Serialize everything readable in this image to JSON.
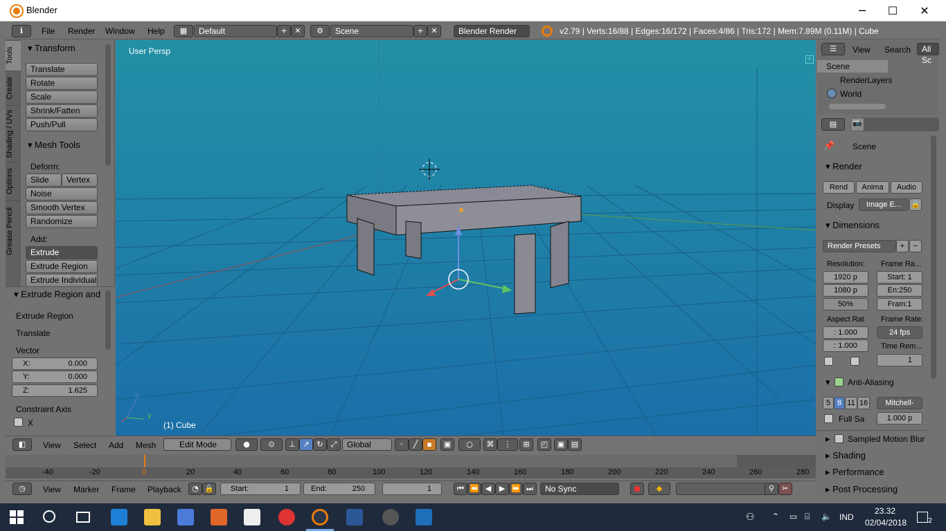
{
  "window": {
    "title": "Blender",
    "minimize": "─",
    "maximize": "☐",
    "close": "✕"
  },
  "menubar": {
    "info_icon": "ℹ",
    "menus": [
      "File",
      "Render",
      "Window",
      "Help"
    ],
    "screen_layout": "Default",
    "scene": "Scene",
    "render_engine": "Blender Render",
    "stats": "v2.79 | Verts:16/88 | Edges:16/172 | Faces:4/86 | Tris:172 | Mem:7.89M (0.11M) | Cube"
  },
  "tool_tabs": [
    "Tools",
    "Create",
    "Shading / UVs",
    "Options",
    "Grease Pencil"
  ],
  "transform_panel": {
    "title": "Transform",
    "buttons": [
      "Translate",
      "Rotate",
      "Scale",
      "Shrink/Fatten",
      "Push/Pull"
    ]
  },
  "mesh_tools_panel": {
    "title": "Mesh Tools",
    "deform_label": "Deform:",
    "slide_edge": "Slide Ed",
    "vertex": "Vertex",
    "buttons": [
      "Noise",
      "Smooth Vertex",
      "Randomize"
    ],
    "add_label": "Add:",
    "extrude": "Extrude",
    "extrude_region": "Extrude Region",
    "extrude_individual": "Extrude Individual"
  },
  "operator_panel": {
    "title": "Extrude Region and",
    "line1": "Extrude Region",
    "line2": "Translate",
    "vector_label": "Vector",
    "x_label": "X:",
    "x_value": "0.000",
    "y_label": "Y:",
    "y_value": "0.000",
    "z_label": "Z:",
    "z_value": "1.625",
    "constraint_label": "Constraint Axis",
    "constraint_x": "X"
  },
  "viewport": {
    "view_name": "User Persp",
    "object_label": "(1) Cube",
    "axis_z": "z",
    "axis_y": "y"
  },
  "view3d_header": {
    "menus": [
      "View",
      "Select",
      "Add",
      "Mesh"
    ],
    "mode": "Edit Mode",
    "orientation": "Global"
  },
  "timeline": {
    "ruler_ticks": [
      "-40",
      "-20",
      "0",
      "20",
      "40",
      "60",
      "80",
      "100",
      "120",
      "140",
      "160",
      "180",
      "200",
      "220",
      "240",
      "260",
      "280"
    ],
    "menus": [
      "View",
      "Marker",
      "Frame",
      "Playback"
    ],
    "start_label": "Start:",
    "start_value": "1",
    "end_label": "End:",
    "end_value": "250",
    "current_frame": "1",
    "sync": "No Sync"
  },
  "outliner": {
    "view": "View",
    "search": "Search",
    "filter": "All Sc",
    "items": [
      "Scene",
      "RenderLayers",
      "World"
    ]
  },
  "properties": {
    "context": "Scene",
    "render_panel": {
      "title": "Render",
      "render_btn": "Rend",
      "anim_btn": "Anima",
      "audio_btn": "Audio",
      "display_label": "Display",
      "display_value": "Image E..."
    },
    "dimensions_panel": {
      "title": "Dimensions",
      "presets": "Render Presets",
      "resolution_label": "Resolution:",
      "res_x": "1920 p",
      "res_y": "1080 p",
      "res_pct": "50%",
      "frame_range_label": "Frame Ra...",
      "start": "Start: 1",
      "end": "En:250",
      "step": "Fram:1",
      "aspect_label": "Aspect Rat",
      "aspect_x": ": 1.000",
      "aspect_y": ": 1.000",
      "frame_rate_label": "Frame Rate:",
      "fps": "24 fps",
      "time_remap_label": "Time Rem...",
      "time_remap": "1"
    },
    "aa_panel": {
      "title": "Anti-Aliasing",
      "samples": [
        "5",
        "8",
        "11",
        "16"
      ],
      "filter": "Mitchell-",
      "full_sample": "Full Sa",
      "filter_size": "1.000 p"
    },
    "collapsed_panels": [
      "Sampled Motion Blur",
      "Shading",
      "Performance",
      "Post Processing"
    ]
  },
  "taskbar": {
    "language": "IND",
    "time": "23.32",
    "date": "02/04/2018",
    "notifications": "2"
  },
  "colors": {
    "viewport_top": "#2390a6",
    "viewport_bottom": "#1b6fa8",
    "ui_gray": "#727272",
    "accent_orange": "#e87d0d",
    "taskbar": "#1f2a3c"
  }
}
